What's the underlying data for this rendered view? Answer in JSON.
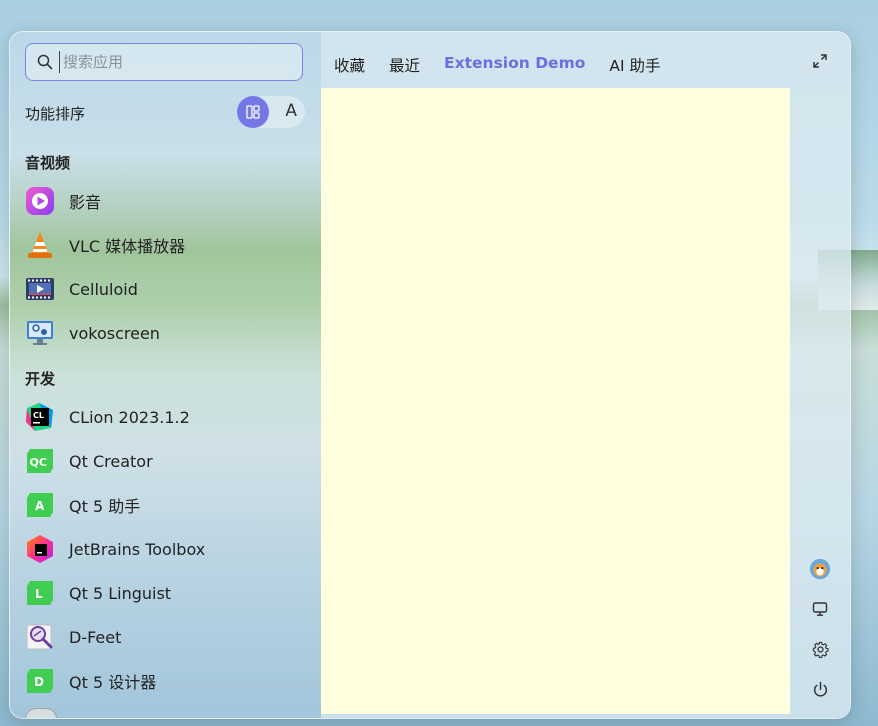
{
  "search": {
    "placeholder": "搜索应用"
  },
  "sort": {
    "label": "功能排序",
    "alpha_label": "A"
  },
  "groups": [
    {
      "title": "音视频",
      "apps": [
        "影音",
        "VLC 媒体播放器",
        "Celluloid",
        "vokoscreen"
      ]
    },
    {
      "title": "开发",
      "apps": [
        "CLion 2023.1.2",
        "Qt Creator",
        "Qt 5 助手",
        "JetBrains Toolbox",
        "Qt 5 Linguist",
        "D-Feet",
        "Qt 5 设计器"
      ]
    }
  ],
  "icon_text": {
    "clion": "CL",
    "qtcreator": "QC",
    "qt_assistant": "A",
    "qt_linguist": "L",
    "qt_designer": "D"
  },
  "tabs": [
    {
      "label": "收藏",
      "active": false
    },
    {
      "label": "最近",
      "active": false
    },
    {
      "label": "Extension Demo",
      "active": true
    },
    {
      "label": "AI 助手",
      "active": false
    }
  ],
  "sidebar_icons": [
    "expand-icon",
    "avatar",
    "computer-icon",
    "gear-icon",
    "power-icon"
  ],
  "colors": {
    "accent": "#7477e6",
    "content_bg": "#ffffdf"
  }
}
